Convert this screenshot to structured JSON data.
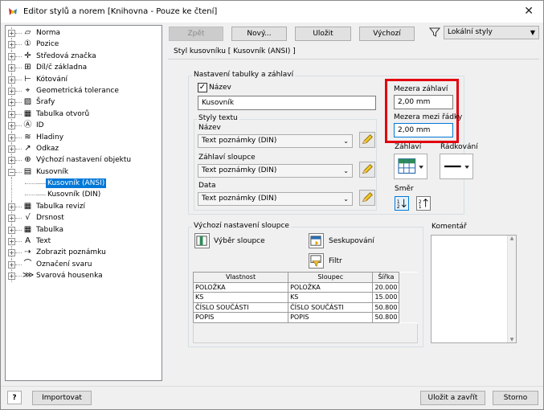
{
  "window": {
    "title": "Editor stylů a norem [Knihovna - Pouze ke čtení]"
  },
  "toolbar": {
    "back_label": "Zpět",
    "new_label": "Nový...",
    "save_label": "Uložit",
    "default_label": "Výchozí",
    "filter_value": "Lokální styly"
  },
  "tree": {
    "items": [
      {
        "label": "Norma",
        "icon": "norm-icon"
      },
      {
        "label": "Pozice",
        "icon": "balloon-icon"
      },
      {
        "label": "Středová značka",
        "icon": "centermark-icon"
      },
      {
        "label": "Díl/č základna",
        "icon": "datum-icon"
      },
      {
        "label": "Kótování",
        "icon": "dimension-icon"
      },
      {
        "label": "Geometrická tolerance",
        "icon": "tolerance-icon"
      },
      {
        "label": "Šrafy",
        "icon": "hatch-icon"
      },
      {
        "label": "Tabulka otvorů",
        "icon": "hole-table-icon"
      },
      {
        "label": "ID",
        "icon": "id-icon"
      },
      {
        "label": "Hladiny",
        "icon": "layers-icon"
      },
      {
        "label": "Odkaz",
        "icon": "leader-icon"
      },
      {
        "label": "Výchozí nastavení objektu",
        "icon": "object-defaults-icon"
      },
      {
        "label": "Kusovník",
        "icon": "parts-list-icon"
      },
      {
        "label": "Tabulka revizí",
        "icon": "revision-table-icon"
      },
      {
        "label": "Drsnost",
        "icon": "surface-texture-icon"
      },
      {
        "label": "Tabulka",
        "icon": "table-icon"
      },
      {
        "label": "Text",
        "icon": "text-icon"
      },
      {
        "label": "Zobrazit poznámku",
        "icon": "view-annotation-icon"
      },
      {
        "label": "Označení svaru",
        "icon": "weld-symbol-icon"
      },
      {
        "label": "Svarová housenka",
        "icon": "weld-bead-icon"
      }
    ],
    "children": [
      {
        "label": "Kusovník (ANSI)",
        "selected": true
      },
      {
        "label": "Kusovník (DIN)",
        "selected": false
      }
    ]
  },
  "panel": {
    "title": "Styl kusovníku [ Kusovník (ANSI) ]",
    "header_group": "Nastavení tabulky a záhlaví",
    "name_checkbox_label": "Název",
    "name_value": "Kusovník",
    "text_styles_group": "Styly textu",
    "title_label": "Název",
    "title_style": "Text poznámky (DIN)",
    "column_header_label": "Záhlaví sloupce",
    "column_header_style": "Text poznámky (DIN)",
    "data_label": "Data",
    "data_style": "Text poznámky (DIN)",
    "header_gap_label": "Mezera záhlaví",
    "header_gap_value": "2,00 mm",
    "row_gap_label": "Mezera mezi řádky",
    "row_gap_value": "2,00 mm",
    "heading_label": "Záhlaví",
    "lines_label": "Řádkování",
    "direction_label": "Směr",
    "columns_group": "Výchozí nastavení sloupce",
    "choose_column_label": "Výběr sloupce",
    "group_label": "Seskupování",
    "filter_label": "Filtr",
    "comment_label": "Komentář"
  },
  "columns_table": {
    "headers": [
      "Vlastnost",
      "Sloupec",
      "Šířka"
    ],
    "rows": [
      [
        "POLOŽKA",
        "POLOŽKA",
        "20.000"
      ],
      [
        "KS",
        "KS",
        "15.000"
      ],
      [
        "ČÍSLO SOUČÁSTI",
        "ČÍSLO SOUČÁSTI",
        "50.800"
      ],
      [
        "POPIS",
        "POPIS",
        "50.800"
      ]
    ]
  },
  "footer": {
    "help_label": "?",
    "import_label": "Importovat",
    "save_close_label": "Uložit a zavřít",
    "cancel_label": "Storno"
  },
  "colors": {
    "selection": "#0078d7",
    "highlight_border": "#e2000e"
  }
}
